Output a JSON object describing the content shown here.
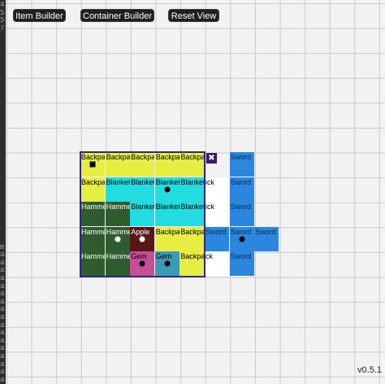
{
  "toolbar": {
    "item_builder_label": "Item Builder",
    "container_builder_label": "Container Builder",
    "reset_view_label": "Reset View"
  },
  "version": "v0.5.1",
  "close_glyph": "✖",
  "sidebar_chars": [
    "4",
    "5",
    "5",
    "7",
    "",
    "",
    "",
    "",
    "",
    "",
    "",
    "",
    "",
    "",
    "",
    "",
    "",
    "",
    "",
    "",
    "",
    "",
    "",
    "",
    "",
    "",
    "",
    "",
    "",
    "",
    "",
    "m",
    "ai",
    "ai",
    "ai",
    "ai",
    "ai",
    "ai",
    "ai",
    "ai",
    "ai",
    "ai",
    "ai",
    "ai",
    "ai",
    "ai",
    "ai",
    "ai",
    "ai"
  ],
  "colors": {
    "backpack": "#e6ee44",
    "blanket": "#22dce0",
    "hammer": "#2f5c2f",
    "apple": "#5a1616",
    "gem_pink": "#c44f95",
    "gem_teal": "#3a9ab8",
    "sword": "#2b86de",
    "container_border": "#2d2a7a"
  },
  "cells": [
    {
      "row": 0,
      "col": 0,
      "label": "Backpack",
      "type": "backpack",
      "marker": "square"
    },
    {
      "row": 0,
      "col": 1,
      "label": "Backpack",
      "type": "backpack",
      "marker": ""
    },
    {
      "row": 0,
      "col": 2,
      "label": "Backpack",
      "type": "backpack",
      "marker": ""
    },
    {
      "row": 0,
      "col": 3,
      "label": "Backpack",
      "type": "backpack",
      "marker": ""
    },
    {
      "row": 0,
      "col": 4,
      "label": "Backpack",
      "type": "backpack",
      "marker": ""
    },
    {
      "row": 0,
      "col": 6,
      "label": "Sword",
      "type": "sword",
      "marker": ""
    },
    {
      "row": 1,
      "col": 0,
      "label": "Backpack",
      "type": "backpack",
      "marker": ""
    },
    {
      "row": 1,
      "col": 1,
      "label": "Blanket",
      "type": "blanket",
      "marker": ""
    },
    {
      "row": 1,
      "col": 2,
      "label": "Blanket",
      "type": "blanket",
      "marker": ""
    },
    {
      "row": 1,
      "col": 3,
      "label": "Blanket",
      "type": "blanket",
      "marker": "dot"
    },
    {
      "row": 1,
      "col": 4,
      "label": "Blanket",
      "type": "blanket",
      "marker": ""
    },
    {
      "row": 1,
      "col": 5,
      "label": "ick",
      "type": "none",
      "marker": ""
    },
    {
      "row": 1,
      "col": 6,
      "label": "Sword",
      "type": "sword",
      "marker": ""
    },
    {
      "row": 2,
      "col": 0,
      "label": "Hammer",
      "type": "hammer",
      "marker": ""
    },
    {
      "row": 2,
      "col": 1,
      "label": "Hammer",
      "type": "hammer",
      "marker": ""
    },
    {
      "row": 2,
      "col": 2,
      "label": "Blanket",
      "type": "blanket",
      "marker": ""
    },
    {
      "row": 2,
      "col": 3,
      "label": "Blanket",
      "type": "blanket",
      "marker": ""
    },
    {
      "row": 2,
      "col": 4,
      "label": "Blanket",
      "type": "blanket",
      "marker": ""
    },
    {
      "row": 2,
      "col": 5,
      "label": "ick",
      "type": "none",
      "marker": ""
    },
    {
      "row": 2,
      "col": 6,
      "label": "Sword",
      "type": "sword",
      "marker": ""
    },
    {
      "row": 3,
      "col": 0,
      "label": "Hammer",
      "type": "hammer",
      "marker": ""
    },
    {
      "row": 3,
      "col": 1,
      "label": "Hammer",
      "type": "hammer",
      "marker": "wdot"
    },
    {
      "row": 3,
      "col": 2,
      "label": "Apple",
      "type": "apple",
      "marker": "wdot"
    },
    {
      "row": 3,
      "col": 3,
      "label": "Backpack",
      "type": "backpack",
      "marker": ""
    },
    {
      "row": 3,
      "col": 4,
      "label": "Backpack",
      "type": "backpack",
      "marker": ""
    },
    {
      "row": 3,
      "col": 5,
      "label": "Sword",
      "type": "sword",
      "marker": ""
    },
    {
      "row": 3,
      "col": 6,
      "label": "Sword",
      "type": "sword",
      "marker": "dot"
    },
    {
      "row": 3,
      "col": 7,
      "label": "Sword",
      "type": "sword",
      "marker": ""
    },
    {
      "row": 4,
      "col": 0,
      "label": "Hammer",
      "type": "hammer",
      "marker": ""
    },
    {
      "row": 4,
      "col": 1,
      "label": "Hammer",
      "type": "hammer",
      "marker": ""
    },
    {
      "row": 4,
      "col": 2,
      "label": "Gem",
      "type": "gem_pink",
      "marker": "dot"
    },
    {
      "row": 4,
      "col": 3,
      "label": "Gem",
      "type": "gem_teal",
      "marker": "dot"
    },
    {
      "row": 4,
      "col": 4,
      "label": "Backpack",
      "type": "backpack",
      "marker": ""
    },
    {
      "row": 4,
      "col": 5,
      "label": "ck",
      "type": "none",
      "marker": ""
    },
    {
      "row": 4,
      "col": 6,
      "label": "Sword",
      "type": "sword",
      "marker": ""
    }
  ]
}
